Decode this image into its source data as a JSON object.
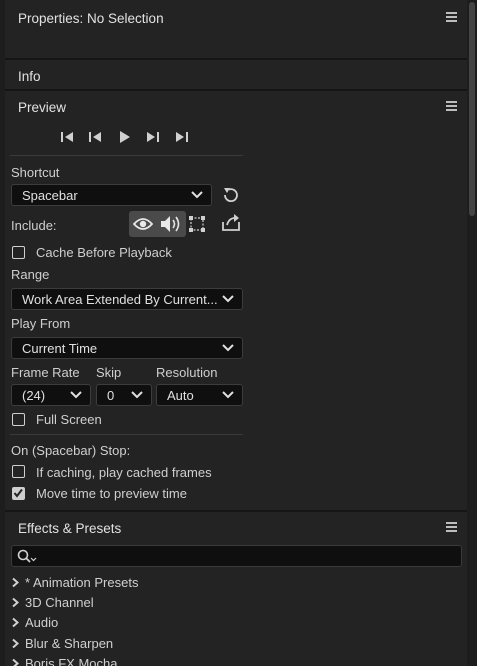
{
  "properties": {
    "title": "Properties: No Selection"
  },
  "info": {
    "title": "Info"
  },
  "preview": {
    "title": "Preview",
    "shortcut": {
      "label": "Shortcut",
      "value": "Spacebar"
    },
    "include": {
      "label": "Include:"
    },
    "cache_before_playback": {
      "label": "Cache Before Playback",
      "checked": false
    },
    "range": {
      "label": "Range",
      "value": "Work Area Extended By Current..."
    },
    "play_from": {
      "label": "Play From",
      "value": "Current Time"
    },
    "frame_rate": {
      "label": "Frame Rate",
      "value": "(24)"
    },
    "skip": {
      "label": "Skip",
      "value": "0"
    },
    "resolution": {
      "label": "Resolution",
      "value": "Auto"
    },
    "full_screen": {
      "label": "Full Screen",
      "checked": false
    },
    "stop": {
      "label": "On (Spacebar) Stop:",
      "options": [
        {
          "label": "If caching, play cached frames",
          "checked": false
        },
        {
          "label": "Move time to preview time",
          "checked": true
        }
      ]
    }
  },
  "effects": {
    "title": "Effects & Presets",
    "search_placeholder": "",
    "items": [
      {
        "label": "* Animation Presets"
      },
      {
        "label": "3D Channel"
      },
      {
        "label": "Audio"
      },
      {
        "label": "Blur & Sharpen"
      },
      {
        "label": "Boris FX Mocha"
      }
    ]
  },
  "colors": {
    "panel_bg": "#232323",
    "field_bg": "#0f0f0f",
    "text": "#d8d8d8",
    "toggle_active": "#4a4a4a"
  },
  "icons": [
    "menu-icon",
    "skip-to-start-icon",
    "step-back-icon",
    "play-icon",
    "step-forward-icon",
    "skip-to-end-icon",
    "reset-shortcut-icon",
    "video-eye-icon",
    "audio-speaker-icon",
    "overlays-icon",
    "export-icon",
    "search-icon",
    "disclosure-arrow-icon"
  ]
}
